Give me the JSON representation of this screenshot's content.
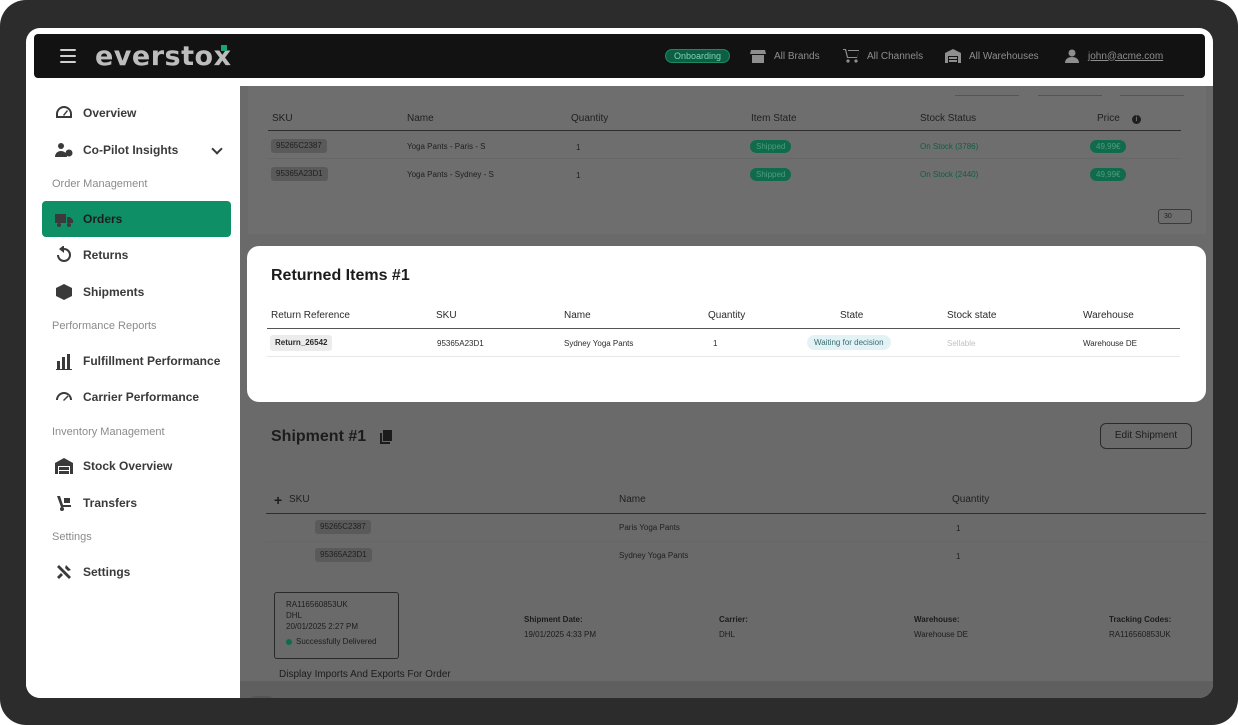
{
  "topbar": {
    "logo": "everstox",
    "badge": "Onboarding",
    "brands": "All Brands",
    "channels": "All Channels",
    "warehouses": "All Warehouses",
    "user": "john@acme.com"
  },
  "sidebar": {
    "items": [
      {
        "label": "Overview",
        "icon": "dashboard-icon"
      },
      {
        "label": "Co-Pilot Insights",
        "icon": "copilot-icon"
      },
      {
        "label": "Orders",
        "icon": "truck-icon"
      },
      {
        "label": "Returns",
        "icon": "return-icon"
      },
      {
        "label": "Shipments",
        "icon": "box-icon"
      },
      {
        "label": "Fulfillment Performance",
        "icon": "bar-chart-icon"
      },
      {
        "label": "Carrier Performance",
        "icon": "gauge-icon"
      },
      {
        "label": "Stock Overview",
        "icon": "warehouse-icon"
      },
      {
        "label": "Transfers",
        "icon": "transfer-icon"
      },
      {
        "label": "Settings",
        "icon": "tools-icon"
      }
    ],
    "sections": [
      "Order Management",
      "Performance Reports",
      "Inventory Management",
      "Settings"
    ]
  },
  "items_table": {
    "headers": [
      "SKU",
      "Name",
      "Quantity",
      "Item State",
      "Stock Status",
      "Price"
    ],
    "rows": [
      {
        "sku": "95265C2387",
        "name": "Yoga Pants - Paris - S",
        "qty": "1",
        "state": "Shipped",
        "stock": "On Stock (3786)",
        "price": "49,99€"
      },
      {
        "sku": "95365A23D1",
        "name": "Yoga Pants - Sydney - S",
        "qty": "1",
        "state": "Shipped",
        "stock": "On Stock (2440)",
        "price": "49,99€"
      }
    ],
    "per_page": "30"
  },
  "returned": {
    "title": "Returned Items #1",
    "headers": [
      "Return Reference",
      "SKU",
      "Name",
      "Quantity",
      "State",
      "Stock state",
      "Warehouse"
    ],
    "row": {
      "ref": "Return_26542",
      "sku": "95365A23D1",
      "name": "Sydney Yoga Pants",
      "qty": "1",
      "state": "Waiting for decision",
      "stock": "Sellable",
      "warehouse": "Warehouse DE"
    }
  },
  "shipment": {
    "title": "Shipment #1",
    "edit": "Edit Shipment",
    "headers": [
      "SKU",
      "Name",
      "Quantity"
    ],
    "rows": [
      {
        "sku": "95265C2387",
        "name": "Paris Yoga Pants",
        "qty": "1"
      },
      {
        "sku": "95365A23D1",
        "name": "Sydney Yoga Pants",
        "qty": "1"
      }
    ],
    "tracking_box": {
      "code": "RA116560853UK",
      "carrier": "DHL",
      "date": "20/01/2025 2:27 PM",
      "status": "Successfully Delivered"
    },
    "meta": {
      "date_label": "Shipment Date:",
      "date_value": "19/01/2025 4:33 PM",
      "carrier_label": "Carrier:",
      "carrier_value": "DHL",
      "warehouse_label": "Warehouse:",
      "warehouse_value": "Warehouse DE",
      "tracking_label": "Tracking Codes:",
      "tracking_value": "RA116560853UK"
    }
  },
  "footer": {
    "toggle_label": "Display Imports And Exports For Order"
  }
}
